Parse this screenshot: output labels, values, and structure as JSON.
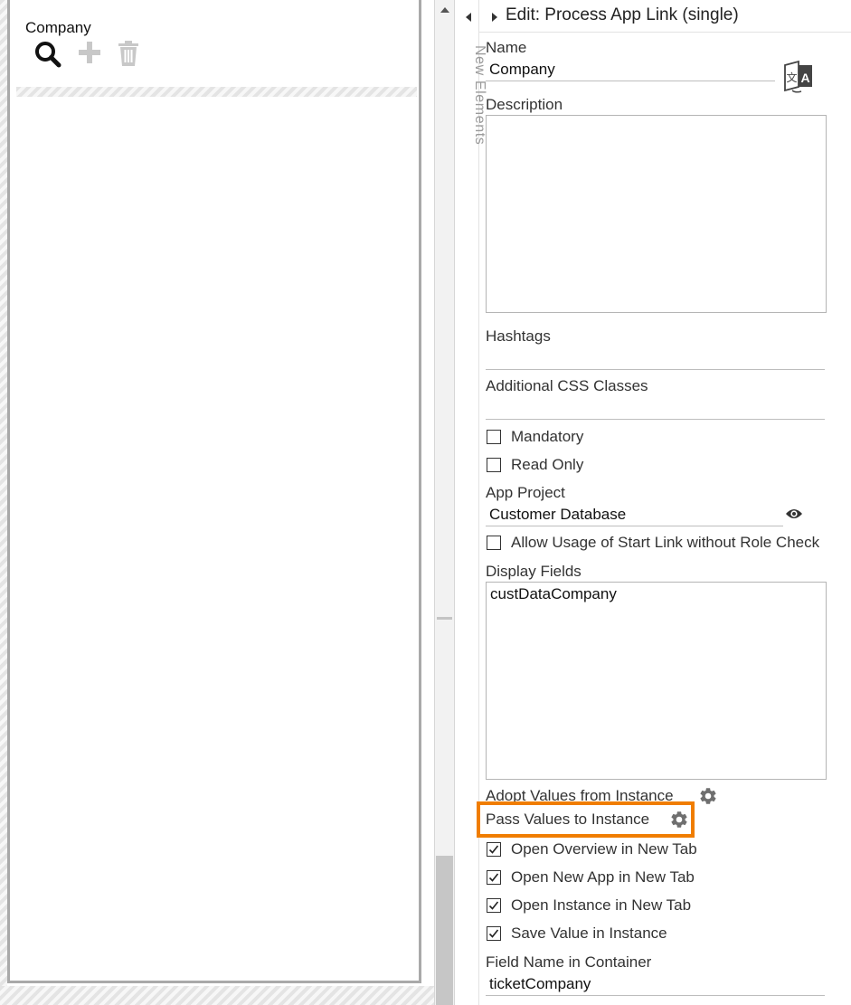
{
  "canvas": {
    "field_label": "Company",
    "tools": [
      "search-icon",
      "plus-icon",
      "trash-icon"
    ]
  },
  "sidebar": {
    "label": "New Elements"
  },
  "panel": {
    "title": "Edit: Process App Link (single)",
    "name": {
      "label": "Name",
      "value": "Company"
    },
    "description": {
      "label": "Description",
      "value": ""
    },
    "hashtags": {
      "label": "Hashtags",
      "value": ""
    },
    "css_classes": {
      "label": "Additional CSS Classes",
      "value": ""
    },
    "mandatory": {
      "label": "Mandatory",
      "checked": false
    },
    "read_only": {
      "label": "Read Only",
      "checked": false
    },
    "app_project": {
      "label": "App Project",
      "value": "Customer Database"
    },
    "allow_start_link": {
      "label": "Allow Usage of Start Link without Role Check",
      "checked": false
    },
    "display_fields": {
      "label": "Display Fields",
      "value": "custDataCompany"
    },
    "adopt_values": {
      "label": "Adopt Values from Instance"
    },
    "pass_values": {
      "label": "Pass Values to Instance"
    },
    "open_overview": {
      "label": "Open Overview in New Tab",
      "checked": true
    },
    "open_new_app": {
      "label": "Open New App in New Tab",
      "checked": true
    },
    "open_instance": {
      "label": "Open Instance in New Tab",
      "checked": true
    },
    "save_value": {
      "label": "Save Value in Instance",
      "checked": true
    },
    "field_name": {
      "label": "Field Name in Container",
      "value": "ticketCompany"
    }
  },
  "colors": {
    "highlight": "#f07d00",
    "icon_gray": "#6f6f6f",
    "disabled_icon": "#c8c8c8"
  }
}
